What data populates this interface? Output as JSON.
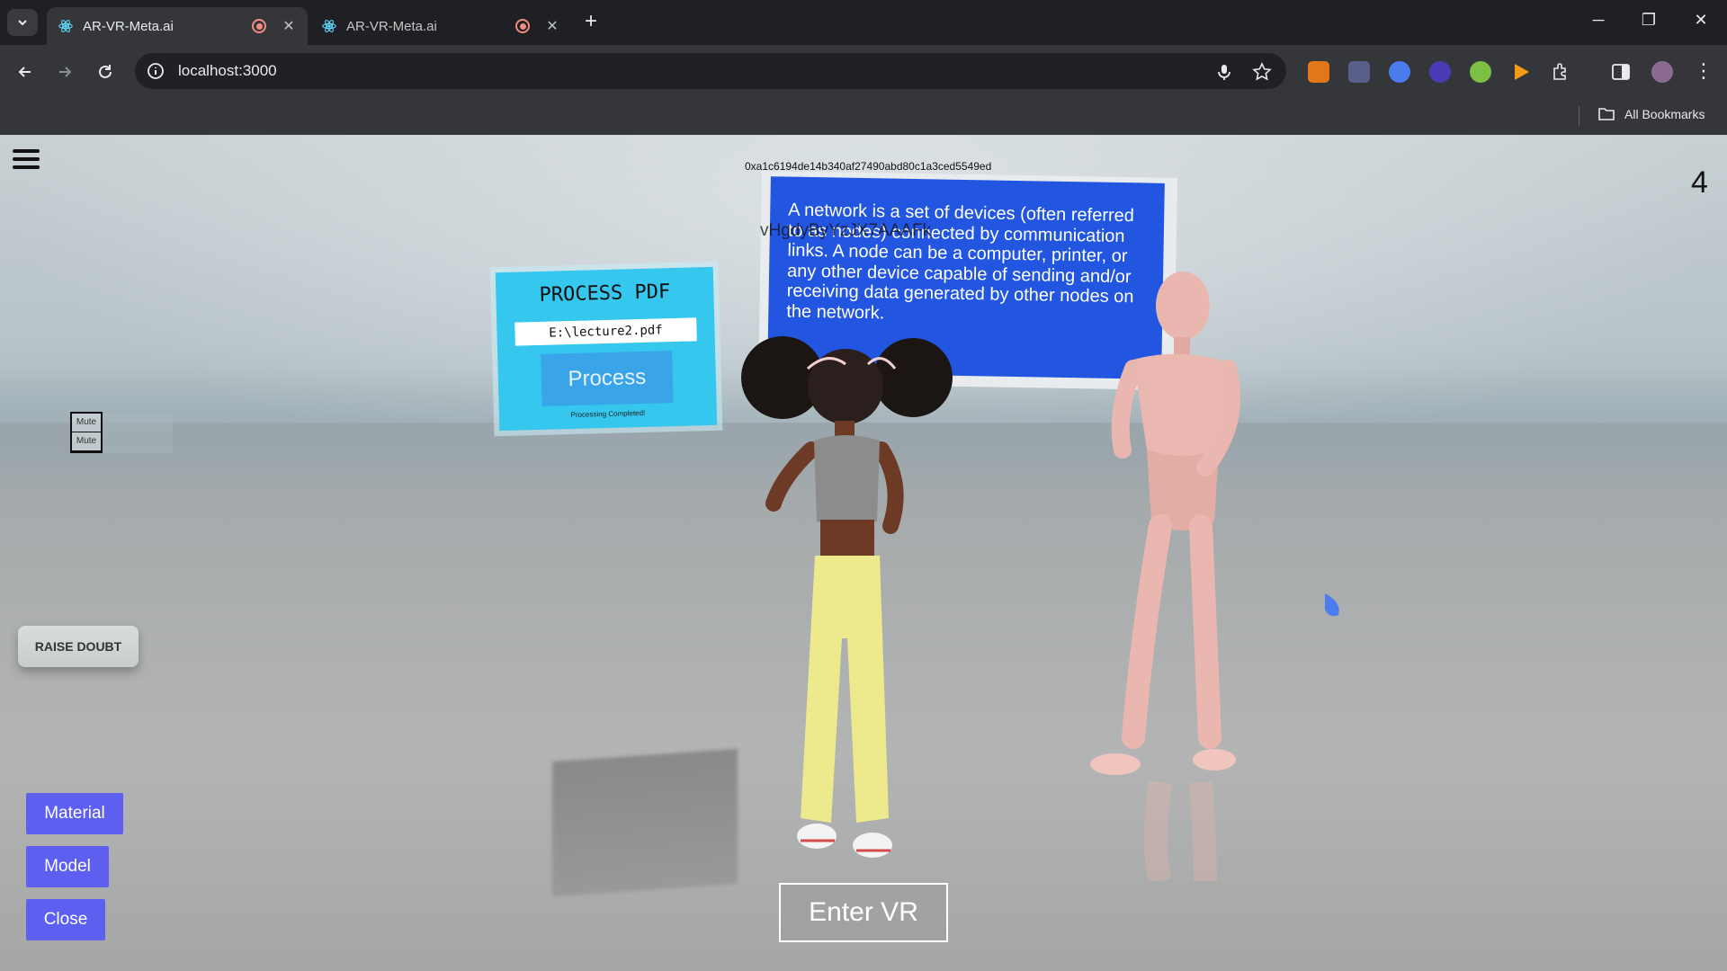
{
  "browser": {
    "tabs": [
      {
        "title": "AR-VR-Meta.ai",
        "active": true
      },
      {
        "title": "AR-VR-Meta.ai",
        "active": false
      }
    ],
    "url": "localhost:3000",
    "bookmarks_label": "All Bookmarks"
  },
  "scene": {
    "hash": "0xa1c6194de14b340af27490abd80c1a3ced5549ed",
    "counter": "4",
    "mute_labels": [
      "Mute",
      "Mute"
    ],
    "overlap_text": "vHgdyByYzJX7AAAFk",
    "board_text": "A network is a set of devices (often referred to as nodes) connected by communication links. A node can be a computer, printer, or any other device capable of sending and/or receiving data generated by other nodes on the network.",
    "pdf": {
      "title": "PROCESS PDF",
      "input_value": "E:\\lecture2.pdf",
      "button": "Process",
      "status": "Processing Completed!"
    },
    "raise_doubt": "RAISE DOUBT",
    "side_buttons": {
      "material": "Material",
      "model": "Model",
      "close": "Close"
    },
    "enter_vr": "Enter VR"
  },
  "colors": {
    "side_button": "#5d5ff0",
    "board": "#2256e0",
    "pdf_panel": "#35c7ee"
  }
}
